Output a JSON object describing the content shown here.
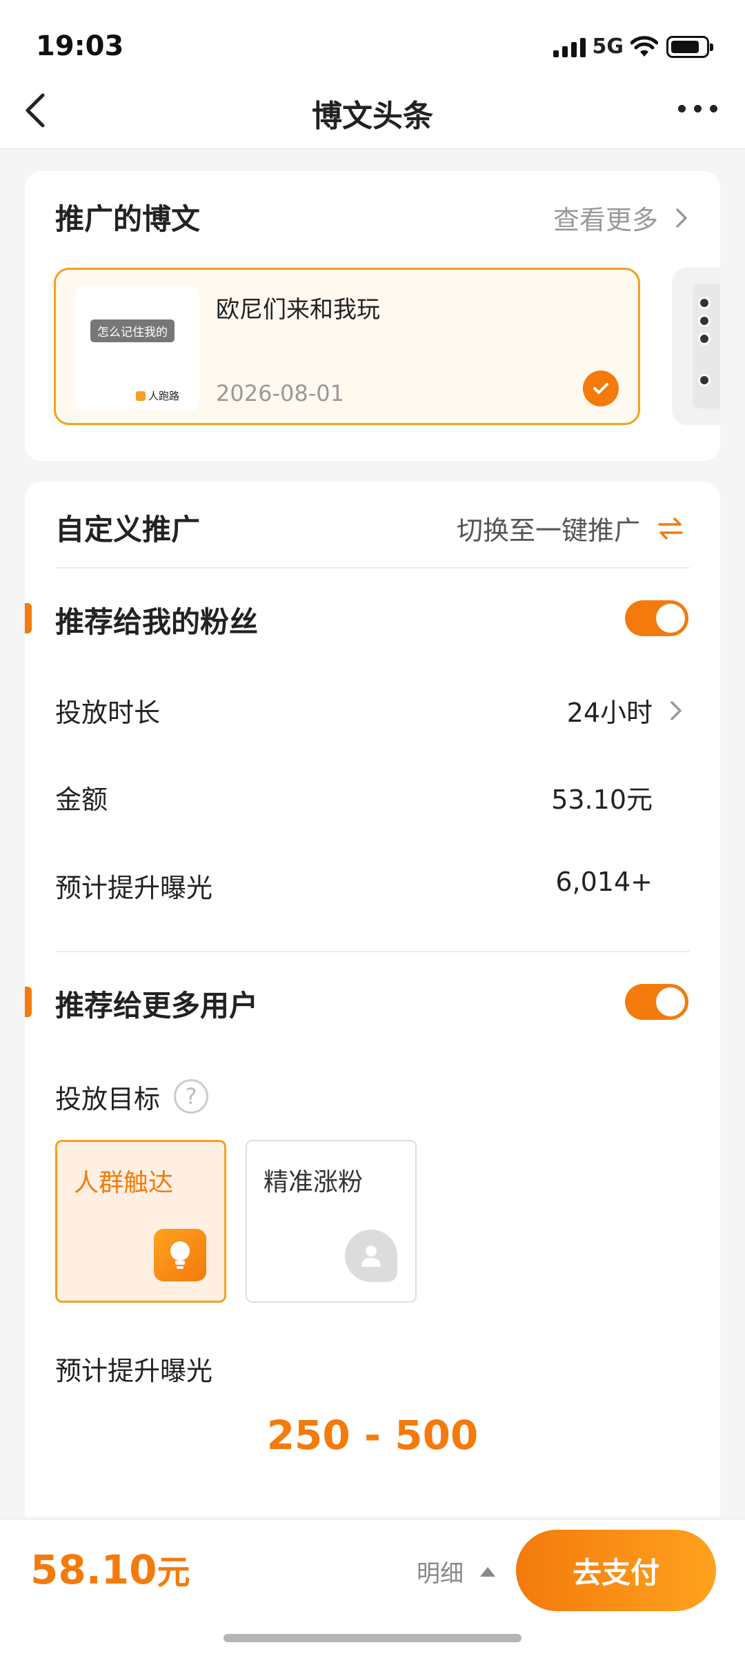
{
  "status_bar": {
    "time": "19:03",
    "network": "5G"
  },
  "nav": {
    "title": "博文头条"
  },
  "promoted_posts": {
    "section_title": "推广的博文",
    "more_label": "查看更多",
    "selected_post": {
      "title": "欧尼们来和我玩",
      "date": "2026-08-01",
      "thumb_tag": "怎么记住我的",
      "thumb_brand": "人跑路"
    }
  },
  "custom_promo": {
    "section_title": "自定义推广",
    "switch_label": "切换至一键推广",
    "fans": {
      "title": "推荐给我的粉丝",
      "enabled": true,
      "duration_label": "投放时长",
      "duration_value": "24小时",
      "amount_label": "金额",
      "amount_value": "53.10元",
      "exposure_label": "预计提升曝光",
      "exposure_value": "6,014+"
    },
    "more_users": {
      "title": "推荐给更多用户",
      "enabled": true,
      "goal_label": "投放目标",
      "help_symbol": "?",
      "options": [
        {
          "label": "人群触达",
          "selected": true,
          "icon": "lightbulb-icon"
        },
        {
          "label": "精准涨粉",
          "selected": false,
          "icon": "user-icon"
        }
      ],
      "exposure_label": "预计提升曝光",
      "exposure_range": "250 - 500"
    }
  },
  "footer": {
    "total_amount": "58.10",
    "total_unit": "元",
    "detail_label": "明细",
    "pay_label": "去支付"
  },
  "colors": {
    "accent": "#f47a0c",
    "accent_light": "#ffa21e",
    "selected_bg": "#fff0e3"
  }
}
